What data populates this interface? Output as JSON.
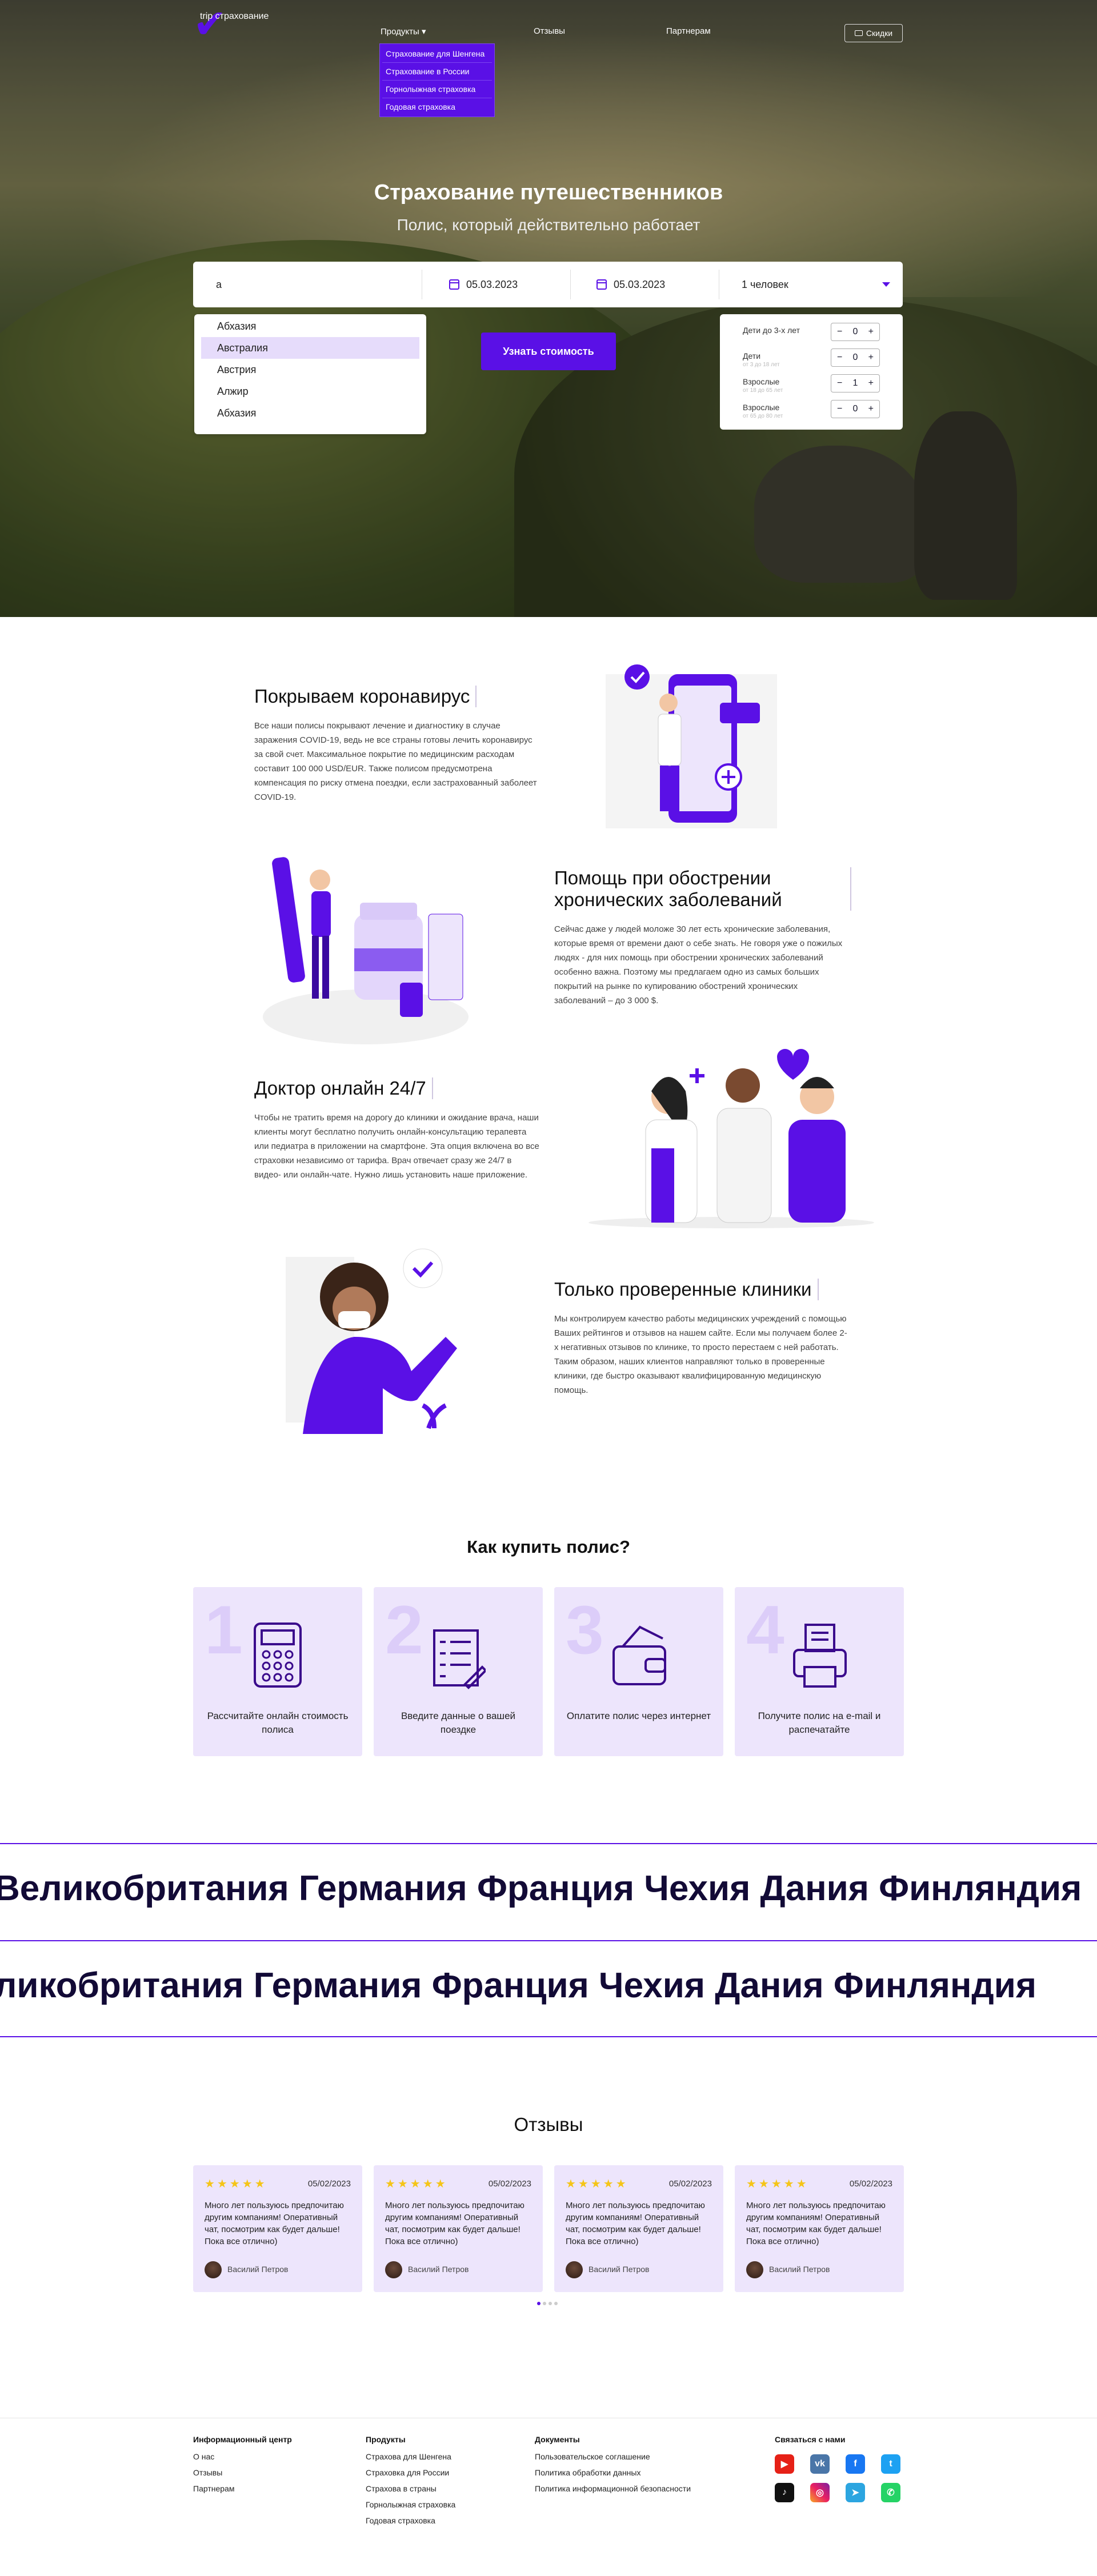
{
  "nav": {
    "logo": "trip страхование",
    "products": "Продукты",
    "reviews": "Отзывы",
    "partners": "Партнерам",
    "discounts": "Скидки",
    "products_menu": [
      "Страхование для Шенгена",
      "Страхование в России",
      "Горнолыжная страховка",
      "Годовая страховка"
    ]
  },
  "hero": {
    "title": "Страхование путешественников",
    "subtitle": "Полис, который действительно работает"
  },
  "search": {
    "country_value": "а",
    "date_from": "05.03.2023",
    "date_to": "05.03.2023",
    "travelers": "1 человек",
    "button": "Узнать стоимость",
    "country_options": [
      "Абхазия",
      "Австралия",
      "Австрия",
      "Алжир",
      "Абхазия"
    ],
    "selected_option": "Австралия"
  },
  "passengers": [
    {
      "label": "Дети до 3-х лет",
      "sub": "",
      "value": "0"
    },
    {
      "label": "Дети",
      "sub": "от 3 до 18 лет",
      "value": "0"
    },
    {
      "label": "Взрослые",
      "sub": "от 18 до 65 лет",
      "value": "1"
    },
    {
      "label": "Взрослые",
      "sub": "от 65 до 80 лет",
      "value": "0"
    }
  ],
  "features": [
    {
      "title": "Покрываем коронавирус",
      "text": "Все наши полисы покрывают лечение и диагностику в случае заражения COVID-19, ведь не все страны готовы лечить коронавирус за свой счет. Максимальное покрытие по медицинским расходам составит 100 000 USD/EUR. Также полисом предусмотрена компенсация по риску отмена поездки, если застрахованный заболеет COVID-19."
    },
    {
      "title": "Помощь при обострении хронических заболеваний",
      "text": "Сейчас даже у людей моложе 30 лет есть хронические заболевания, которые время от времени дают о себе знать. Не говоря уже о пожилых людях - для них помощь при обострении хронических заболеваний особенно важна. Поэтому мы предлагаем одно из самых больших покрытий на рынке по купированию обострений хронических заболеваний – до 3 000 $."
    },
    {
      "title": "Доктор онлайн 24/7",
      "text": "Чтобы не тратить время на дорогу до клиники и ожидание врача, наши клиенты могут бесплатно получить онлайн-консультацию терапевта или педиатра в приложении на смартфоне. Эта опция включена во все страховки независимо от тарифа. Врач отвечает сразу же 24/7 в видео- или онлайн-чате. Нужно лишь установить наше приложение."
    },
    {
      "title": "Только проверенные клиники",
      "text": "Мы контролируем качество работы медицинских учреждений с помощью Ваших рейтингов и отзывов на нашем сайте. Если мы получаем более 2-х негативных отзывов по клинике, то просто перестаем с ней работать. Таким образом, наших клиентов направляют только в проверенные клиники, где быстро оказывают квалифицированную медицинскую помощь."
    }
  ],
  "how": {
    "title": "Как купить полис?",
    "steps": [
      {
        "num": "1",
        "caption": "Рассчитайте онлайн стоимость полиса"
      },
      {
        "num": "2",
        "caption": "Введите данные о вашей поездке"
      },
      {
        "num": "3",
        "caption": "Оплатите полис через интернет"
      },
      {
        "num": "4",
        "caption": "Получите полис на e-mail и распечатайте"
      }
    ]
  },
  "marquee": {
    "row1": "Великобритания Германия Франция Чехия Дания Финляндия",
    "row2": "ликобритания Германия Франция Чехия Дания Финляндия"
  },
  "reviews": {
    "title": "Отзывы",
    "items": [
      {
        "stars": "★★★★★",
        "date": "05/02/2023",
        "text": "Много лет пользуюсь предпочитаю другим компаниям! Оперативный чат, посмотрим как будет дальше! Пока все отлично)",
        "name": "Василий Петров"
      },
      {
        "stars": "★★★★★",
        "date": "05/02/2023",
        "text": "Много лет пользуюсь предпочитаю другим компаниям! Оперативный чат, посмотрим как будет дальше! Пока все отлично)",
        "name": "Василий Петров"
      },
      {
        "stars": "★★★★★",
        "date": "05/02/2023",
        "text": "Много лет пользуюсь предпочитаю другим компаниям! Оперативный чат, посмотрим как будет дальше! Пока все отлично)",
        "name": "Василий Петров"
      },
      {
        "stars": "★★★★★",
        "date": "05/02/2023",
        "text": "Много лет пользуюсь предпочитаю другим компаниям! Оперативный чат, посмотрим как будет дальше! Пока все отлично)",
        "name": "Василий Петров"
      }
    ]
  },
  "footer": {
    "info": {
      "title": "Информационный центр",
      "links": [
        "О нас",
        "Отзывы",
        "Партнерам"
      ]
    },
    "products": {
      "title": "Продукты",
      "links": [
        "Страхова для Шенгена",
        "Страховка для России",
        "Страхова в страны",
        "Горнолыжная страховка",
        "Годовая страховка"
      ]
    },
    "docs": {
      "title": "Документы",
      "links": [
        "Пользовательское соглашение",
        "Политика обработки данных",
        "Политика информационной безопасности"
      ]
    },
    "contact": {
      "title": "Связаться с нами"
    },
    "social_icons": [
      "youtube-icon",
      "vk-icon",
      "facebook-icon",
      "twitter-icon",
      "tiktok-icon",
      "instagram-icon",
      "telegram-icon",
      "whatsapp-icon"
    ]
  },
  "colors": {
    "accent": "#5a10e6",
    "card": "#ede5fc"
  }
}
